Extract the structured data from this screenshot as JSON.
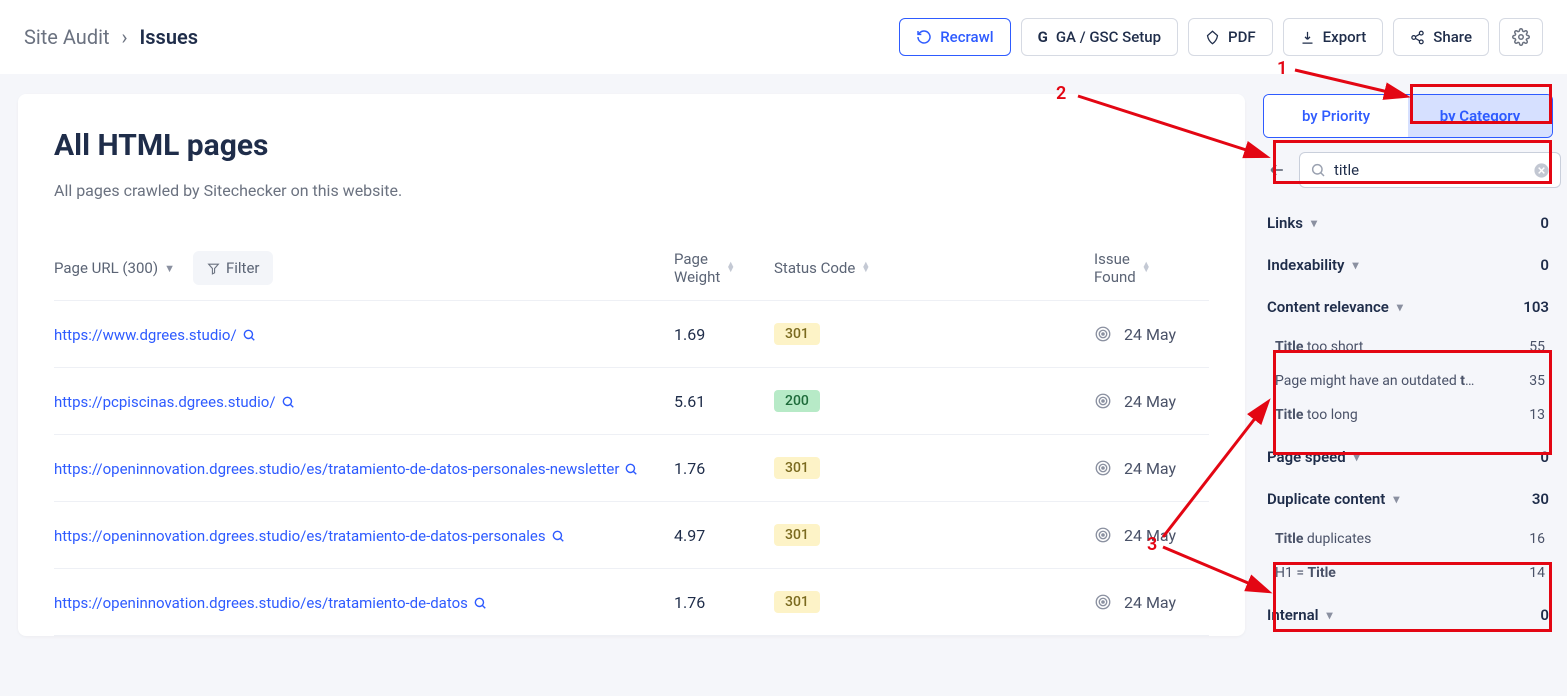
{
  "breadcrumb": {
    "root": "Site Audit",
    "current": "Issues"
  },
  "buttons": {
    "recrawl": "Recrawl",
    "ga_setup": "GA / GSC Setup",
    "pdf": "PDF",
    "export": "Export",
    "share": "Share"
  },
  "page": {
    "title": "All HTML pages",
    "subtitle": "All pages crawled by Sitechecker on this website."
  },
  "columns": {
    "url": "Page URL (300)",
    "filter": "Filter",
    "weight_l1": "Page",
    "weight_l2": "Weight",
    "status": "Status Code",
    "found_l1": "Issue",
    "found_l2": "Found"
  },
  "rows": [
    {
      "url": "https://www.dgrees.studio/",
      "weight": "1.69",
      "status": "301",
      "status_cls": "yellow",
      "found": "24 May"
    },
    {
      "url": "https://pcpiscinas.dgrees.studio/",
      "weight": "5.61",
      "status": "200",
      "status_cls": "green",
      "found": "24 May"
    },
    {
      "url": "https://openinnovation.dgrees.studio/es/tratamiento-de-datos-personales-newsletter",
      "weight": "1.76",
      "status": "301",
      "status_cls": "yellow",
      "found": "24 May"
    },
    {
      "url": "https://openinnovation.dgrees.studio/es/tratamiento-de-datos-personales",
      "weight": "4.97",
      "status": "301",
      "status_cls": "yellow",
      "found": "24 May"
    },
    {
      "url": "https://openinnovation.dgrees.studio/es/tratamiento-de-datos",
      "weight": "1.76",
      "status": "301",
      "status_cls": "yellow",
      "found": "24 May"
    }
  ],
  "side": {
    "tab_priority": "by Priority",
    "tab_category": "by Category",
    "search_value": "title",
    "categories": [
      {
        "name": "Links",
        "count": "0",
        "items": []
      },
      {
        "name": "Indexability",
        "count": "0",
        "items": []
      },
      {
        "name": "Content relevance",
        "count": "103",
        "items": [
          {
            "pre": "Title",
            "rest": " too short",
            "count": "55"
          },
          {
            "pre": "",
            "rest": "Page might have an outdated t…",
            "count": "35",
            "bold_end": true
          },
          {
            "pre": "Title",
            "rest": " too long",
            "count": "13"
          }
        ]
      },
      {
        "name": "Page speed",
        "count": "0",
        "items": []
      },
      {
        "name": "Duplicate content",
        "count": "30",
        "items": [
          {
            "pre": "Title",
            "rest": " duplicates",
            "count": "16"
          },
          {
            "pre": "",
            "rest_pre": "H1 = ",
            "bold": "Title",
            "count": "14"
          }
        ]
      },
      {
        "name": "Internal",
        "count": "0",
        "items": []
      }
    ]
  },
  "annotations": {
    "1": "1",
    "2": "2",
    "3": "3"
  }
}
